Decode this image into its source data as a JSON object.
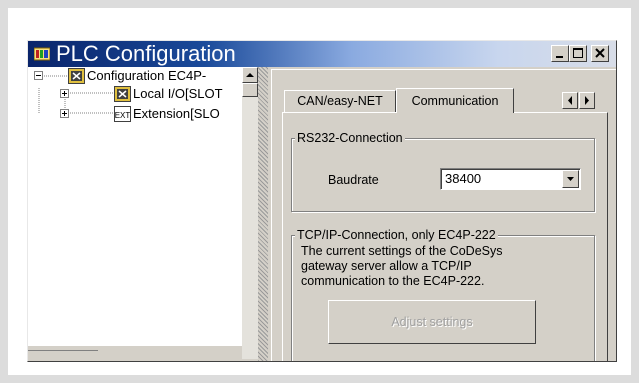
{
  "window": {
    "title": "PLC Configuration",
    "icon": "plc-config-icon",
    "controls": [
      "minimize-icon",
      "maximize-icon",
      "close-icon"
    ]
  },
  "tree": {
    "items": [
      {
        "label": "Configuration EC4P-",
        "icon": "module-icon",
        "expander": "minus",
        "level": 0
      },
      {
        "label": "Local I/O[SLOT",
        "icon": "module-icon",
        "expander": "plus",
        "level": 1
      },
      {
        "label": "Extension[SLO",
        "icon": "ext-icon",
        "icon_text": "EXT",
        "expander": "plus",
        "level": 1
      }
    ]
  },
  "tabs": [
    {
      "label": "CAN/easy-NET",
      "active": false
    },
    {
      "label": "Communication",
      "active": true
    }
  ],
  "rs232": {
    "group_label": "RS232-Connection",
    "baudrate_label": "Baudrate",
    "baudrate_value": "38400"
  },
  "tcpip": {
    "group_label": "TCP/IP-Connection, only EC4P-222",
    "description_lines": [
      "The current settings of the CoDeSys",
      "gateway server allow a TCP/IP",
      "communication to the EC4P-222."
    ],
    "button_label": "Adjust settings"
  },
  "colors": {
    "title_gradient_start": "#0a246a",
    "face": "#d4d0c8",
    "disabled_text": "#a0a0a0"
  }
}
